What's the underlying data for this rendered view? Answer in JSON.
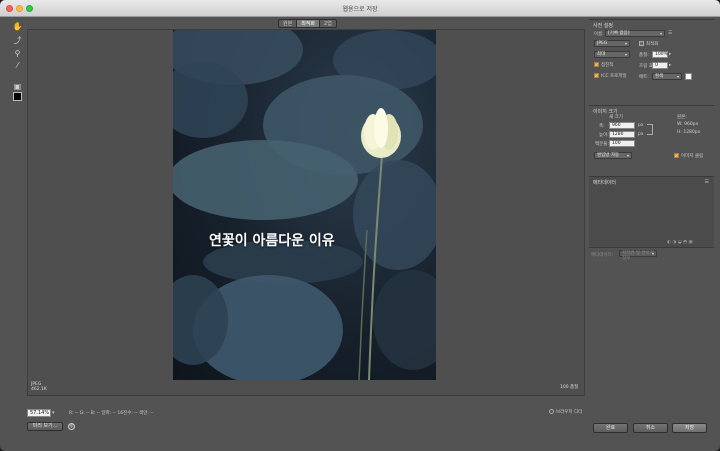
{
  "window": {
    "title": "웹용으로 저장"
  },
  "toolbar": {
    "tools": [
      {
        "name": "hand-tool-icon",
        "glyph": "✋"
      },
      {
        "name": "slice-select-tool-icon",
        "glyph": "⤴"
      },
      {
        "name": "zoom-tool-icon",
        "glyph": "⚲"
      },
      {
        "name": "eyedropper-tool-icon",
        "glyph": "⁄"
      }
    ],
    "swatch_color": "#000000"
  },
  "view_tabs": [
    "원본",
    "최적화",
    "2업"
  ],
  "preview": {
    "overlay_text": "연꽃이 아름다운 이유",
    "format": "JPEG",
    "size": "462.1K",
    "quality": "100 품질"
  },
  "bottom": {
    "zoom": "57.14%",
    "readout": "R: --  G: --  B: --  알파: --  16진수: --  색인: --",
    "side_by_side": "브라우저 디더",
    "preview_button": "미리 보기..."
  },
  "right_panel": {
    "preset_title": "사전 설정",
    "preset_label": "이름:",
    "preset_value": "[기록 없음]",
    "format_value": "JPEG",
    "quality_level": "최대",
    "quality_label": "품질:",
    "quality_value": "100%",
    "optimize_label": "최적화",
    "progressive_label": "점진적",
    "blur_label": "흐림 효과:",
    "blur_value": "0",
    "icc_label": "ICC 프로파일",
    "matte_label": "매트:",
    "matte_value": "흰색",
    "image_size_title": "이미지 크기",
    "new_size_label": "새 크기",
    "width_label": "폭:",
    "width_value": "960",
    "height_label": "높이:",
    "height_value": "1280",
    "unit": "px",
    "percent_label": "백분율:",
    "percent_value": "100",
    "original_label": "원본:",
    "orig_w": "W:  960px",
    "orig_h": "H:  1280px",
    "quality_method": "쌍입방 자동",
    "animation_label": "이미지 클립",
    "metadata_title": "메타데이터",
    "metadata_dd_label": "메타데이터:",
    "metadata_dd_value": "저작권 및 연락처 정보"
  },
  "actions": {
    "done": "완료",
    "cancel": "취소",
    "save": "저장"
  }
}
